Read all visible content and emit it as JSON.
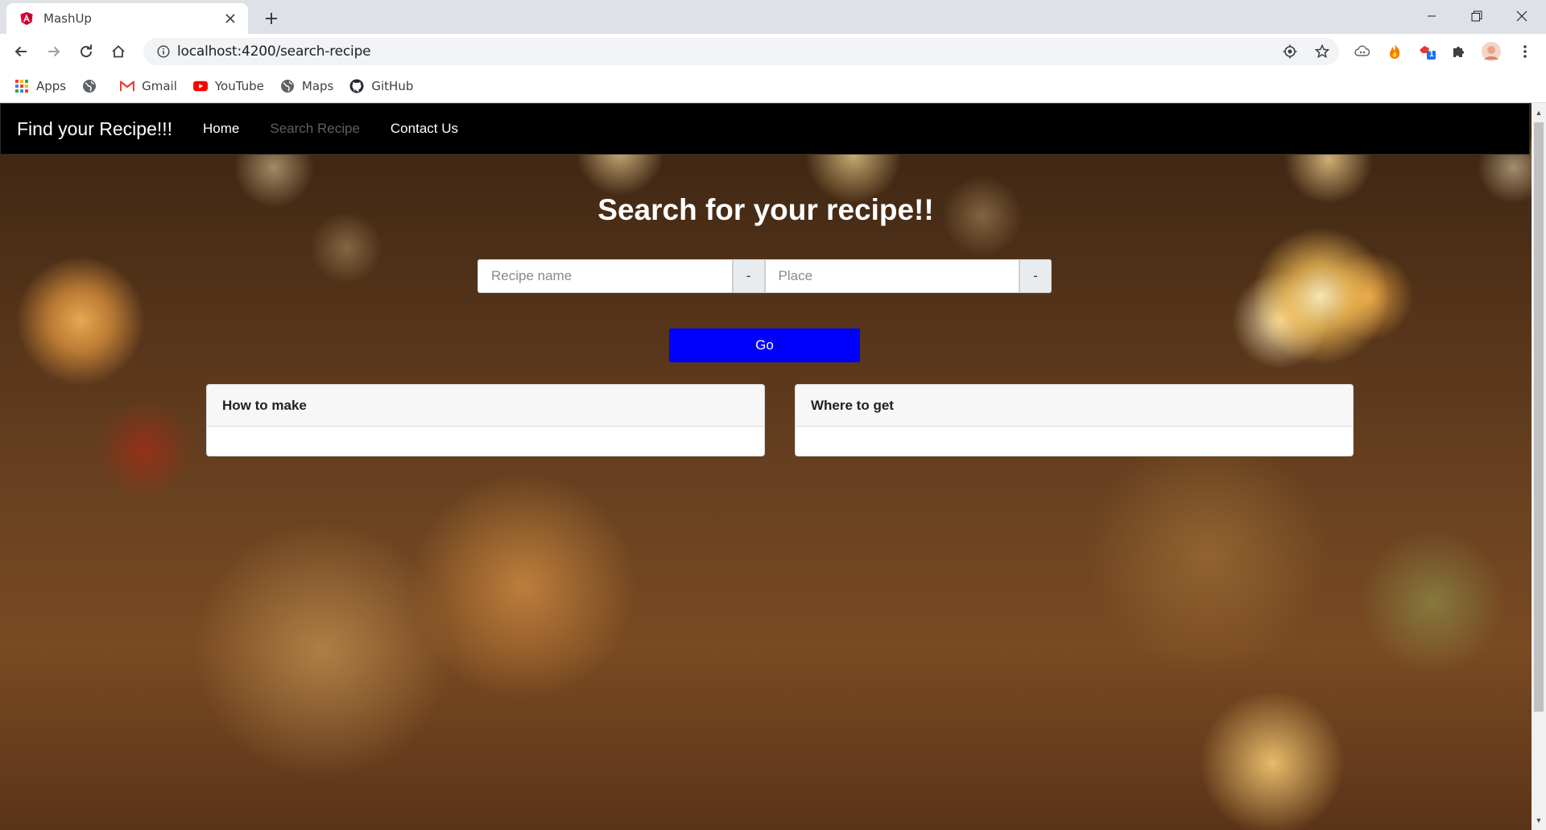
{
  "browser": {
    "tab_title": "MashUp",
    "url": "localhost:4200/search-recipe",
    "extension_badge": "1",
    "bookmarks": [
      {
        "label": "Apps",
        "icon": "apps-grid-icon"
      },
      {
        "label": "",
        "icon": "globe-icon"
      },
      {
        "label": "Gmail",
        "icon": "gmail-icon"
      },
      {
        "label": "YouTube",
        "icon": "youtube-icon"
      },
      {
        "label": "Maps",
        "icon": "globe-icon"
      },
      {
        "label": "GitHub",
        "icon": "github-icon"
      }
    ]
  },
  "navbar": {
    "brand": "Find your Recipe!!!",
    "links": [
      {
        "label": "Home",
        "active": true
      },
      {
        "label": "Search Recipe",
        "disabled": true
      },
      {
        "label": "Contact Us",
        "active": true
      }
    ]
  },
  "main": {
    "heading": "Search for your recipe!!",
    "recipe_placeholder": "Recipe name",
    "recipe_addon": "-",
    "place_placeholder": "Place",
    "place_addon": "-",
    "go_label": "Go"
  },
  "cards": [
    {
      "title": "How to make"
    },
    {
      "title": "Where to get"
    }
  ],
  "colors": {
    "navbar_bg": "#000000",
    "go_button": "#0000ff",
    "disabled_link": "#5f5f5f"
  }
}
